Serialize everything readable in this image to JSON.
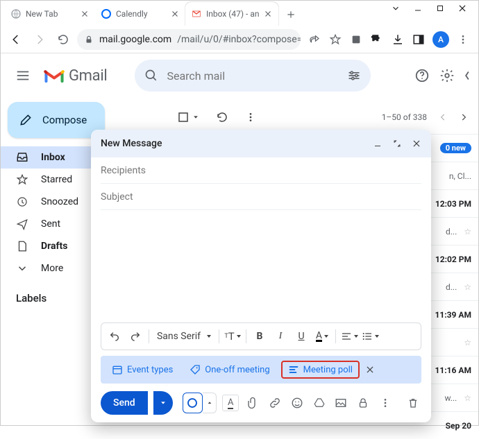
{
  "browser": {
    "tabs": [
      {
        "label": "New Tab"
      },
      {
        "label": "Calendly"
      },
      {
        "label": "Inbox (47) - an"
      }
    ],
    "url_domain": "mail.google.com",
    "url_path": "/mail/u/0/#inbox?compose=...",
    "avatar_letter": "A"
  },
  "gmail": {
    "brand": "Gmail",
    "search_placeholder": "Search mail",
    "compose_label": "Compose",
    "nav": {
      "inbox": "Inbox",
      "starred": "Starred",
      "snoozed": "Snoozed",
      "sent": "Sent",
      "drafts": "Drafts",
      "more": "More"
    },
    "labels_header": "Labels",
    "toolbar": {
      "range": "1–50 of 338"
    },
    "rows": {
      "r1_pill": "0 new",
      "r1_text": "n, Cl...",
      "r2_time": "12:03 PM",
      "r3_text": "d...",
      "r4_time": "12:02 PM",
      "r5_text": "d...",
      "r6_time": "11:39 AM",
      "r8_time": "11:16 AM",
      "r9_text": "w...",
      "r10_time": "Sep 20"
    }
  },
  "compose": {
    "title": "New Message",
    "recipients": "Recipients",
    "subject": "Subject",
    "font_family": "Sans Serif",
    "chips": {
      "event_types": "Event types",
      "oneoff": "One-off meeting",
      "poll": "Meeting poll"
    },
    "send": "Send"
  }
}
